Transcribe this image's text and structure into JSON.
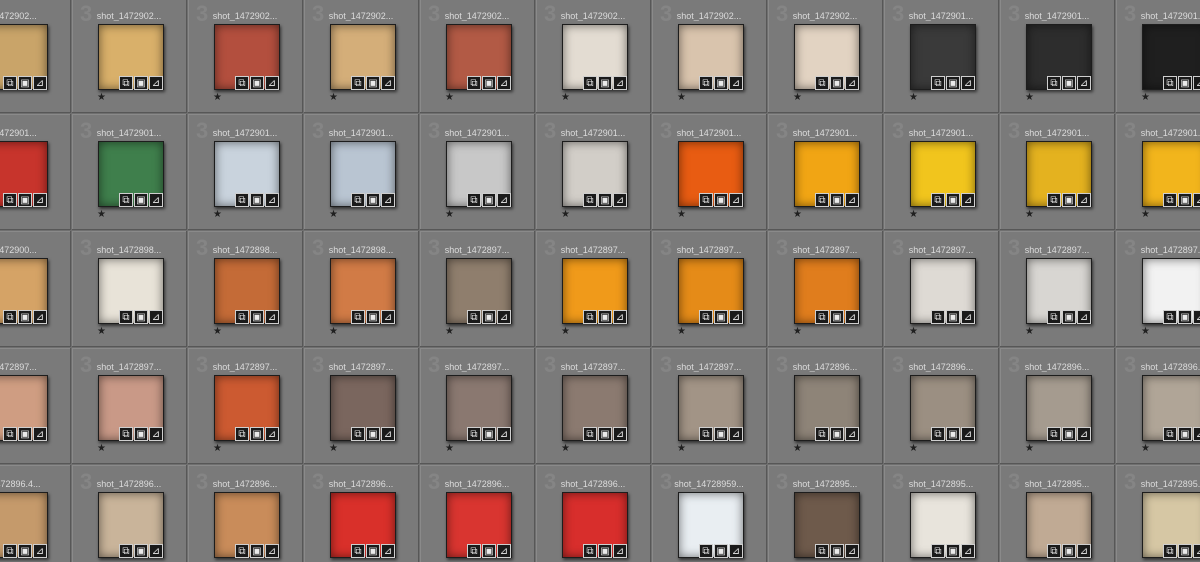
{
  "grid": {
    "rows": [
      {
        "cells": [
          {
            "name": "_1472902...",
            "color": "#c9a469",
            "rating": "★"
          },
          {
            "name": "shot_1472902...",
            "color": "#d9b06a",
            "rating": "★"
          },
          {
            "name": "shot_1472902...",
            "color": "#b34f3e",
            "rating": "★"
          },
          {
            "name": "shot_1472902...",
            "color": "#d4ae79",
            "rating": "★"
          },
          {
            "name": "shot_1472902...",
            "color": "#b25a45",
            "rating": "★"
          },
          {
            "name": "shot_1472902...",
            "color": "#e3dcd2",
            "rating": "★"
          },
          {
            "name": "shot_1472902...",
            "color": "#d9c4ad",
            "rating": "★"
          },
          {
            "name": "shot_1472902...",
            "color": "#e2d3c2",
            "rating": "★"
          },
          {
            "name": "shot_1472901...",
            "color": "#3a3a3a",
            "rating": "★"
          },
          {
            "name": "shot_1472901...",
            "color": "#2d2d2d",
            "rating": "★"
          },
          {
            "name": "shot_1472901...",
            "color": "#1f1f1f",
            "rating": "★"
          }
        ]
      },
      {
        "cells": [
          {
            "name": "_1472901...",
            "color": "#c7342c",
            "rating": "★"
          },
          {
            "name": "shot_1472901...",
            "color": "#3f7f4c",
            "rating": "★"
          },
          {
            "name": "shot_1472901...",
            "color": "#c9d3dd",
            "rating": "★"
          },
          {
            "name": "shot_1472901...",
            "color": "#b9c5d2",
            "rating": "★"
          },
          {
            "name": "shot_1472901...",
            "color": "#c8c8c8",
            "rating": "★"
          },
          {
            "name": "shot_1472901...",
            "color": "#d2cec8",
            "rating": "★"
          },
          {
            "name": "shot_1472901...",
            "color": "#e85c12",
            "rating": "★"
          },
          {
            "name": "shot_1472901...",
            "color": "#f1a514",
            "rating": "★"
          },
          {
            "name": "shot_1472901...",
            "color": "#f1c51d",
            "rating": "★"
          },
          {
            "name": "shot_1472901...",
            "color": "#e4b21f",
            "rating": "★"
          },
          {
            "name": "shot_1472901...",
            "color": "#f2b51c",
            "rating": "★"
          }
        ]
      },
      {
        "cells": [
          {
            "name": "_1472900...",
            "color": "#d5a366",
            "rating": "★"
          },
          {
            "name": "shot_1472898...",
            "color": "#e8e3d8",
            "rating": "★"
          },
          {
            "name": "shot_1472898...",
            "color": "#c46b37",
            "rating": "★"
          },
          {
            "name": "shot_1472898...",
            "color": "#d17b46",
            "rating": "★"
          },
          {
            "name": "shot_1472897...",
            "color": "#8f7e6d",
            "rating": "★"
          },
          {
            "name": "shot_1472897...",
            "color": "#f09a1a",
            "rating": "★"
          },
          {
            "name": "shot_1472897...",
            "color": "#e58b18",
            "rating": "★"
          },
          {
            "name": "shot_1472897...",
            "color": "#e07d1d",
            "rating": "★"
          },
          {
            "name": "shot_1472897...",
            "color": "#dedad4",
            "rating": "★"
          },
          {
            "name": "shot_1472897...",
            "color": "#d8d6d2",
            "rating": "★"
          },
          {
            "name": "shot_1472897...",
            "color": "#f2f2f2",
            "rating": "★"
          }
        ]
      },
      {
        "cells": [
          {
            "name": "_1472897...",
            "color": "#cf9d82",
            "rating": "★"
          },
          {
            "name": "shot_1472897...",
            "color": "#c99987",
            "rating": "★"
          },
          {
            "name": "shot_1472897...",
            "color": "#cc5a31",
            "rating": "★"
          },
          {
            "name": "shot_1472897...",
            "color": "#7a665e",
            "rating": "★"
          },
          {
            "name": "shot_1472897...",
            "color": "#8a7870",
            "rating": "★"
          },
          {
            "name": "shot_1472897...",
            "color": "#8b7a70",
            "rating": "★"
          },
          {
            "name": "shot_1472897...",
            "color": "#a29486",
            "rating": "★"
          },
          {
            "name": "shot_1472896...",
            "color": "#8e8478",
            "rating": "★"
          },
          {
            "name": "shot_1472896...",
            "color": "#9b8f82",
            "rating": "★"
          },
          {
            "name": "shot_1472896...",
            "color": "#a59b8f",
            "rating": "★"
          },
          {
            "name": "shot_1472896...",
            "color": "#b0a597",
            "rating": "★"
          }
        ]
      },
      {
        "cells": [
          {
            "name": "_1472896.4...",
            "color": "#c59a6b",
            "rating": ""
          },
          {
            "name": "shot_1472896...",
            "color": "#c9b49a",
            "rating": ""
          },
          {
            "name": "shot_1472896...",
            "color": "#c98c5a",
            "rating": ""
          },
          {
            "name": "shot_1472896...",
            "color": "#d9302a",
            "rating": ""
          },
          {
            "name": "shot_1472896...",
            "color": "#d93530",
            "rating": ""
          },
          {
            "name": "shot_1472896...",
            "color": "#d82e2c",
            "rating": ""
          },
          {
            "name": "shot_14728959...",
            "color": "#e9eef2",
            "rating": ""
          },
          {
            "name": "shot_1472895...",
            "color": "#6e5a4b",
            "rating": ""
          },
          {
            "name": "shot_1472895...",
            "color": "#e8e4dc",
            "rating": ""
          },
          {
            "name": "shot_1472895...",
            "color": "#c0aa94",
            "rating": ""
          },
          {
            "name": "shot_1472895...",
            "color": "#d6c7a4",
            "rating": ""
          }
        ]
      }
    ],
    "watermark": "3",
    "badges": [
      "⧉",
      "▣",
      "⊿"
    ]
  }
}
